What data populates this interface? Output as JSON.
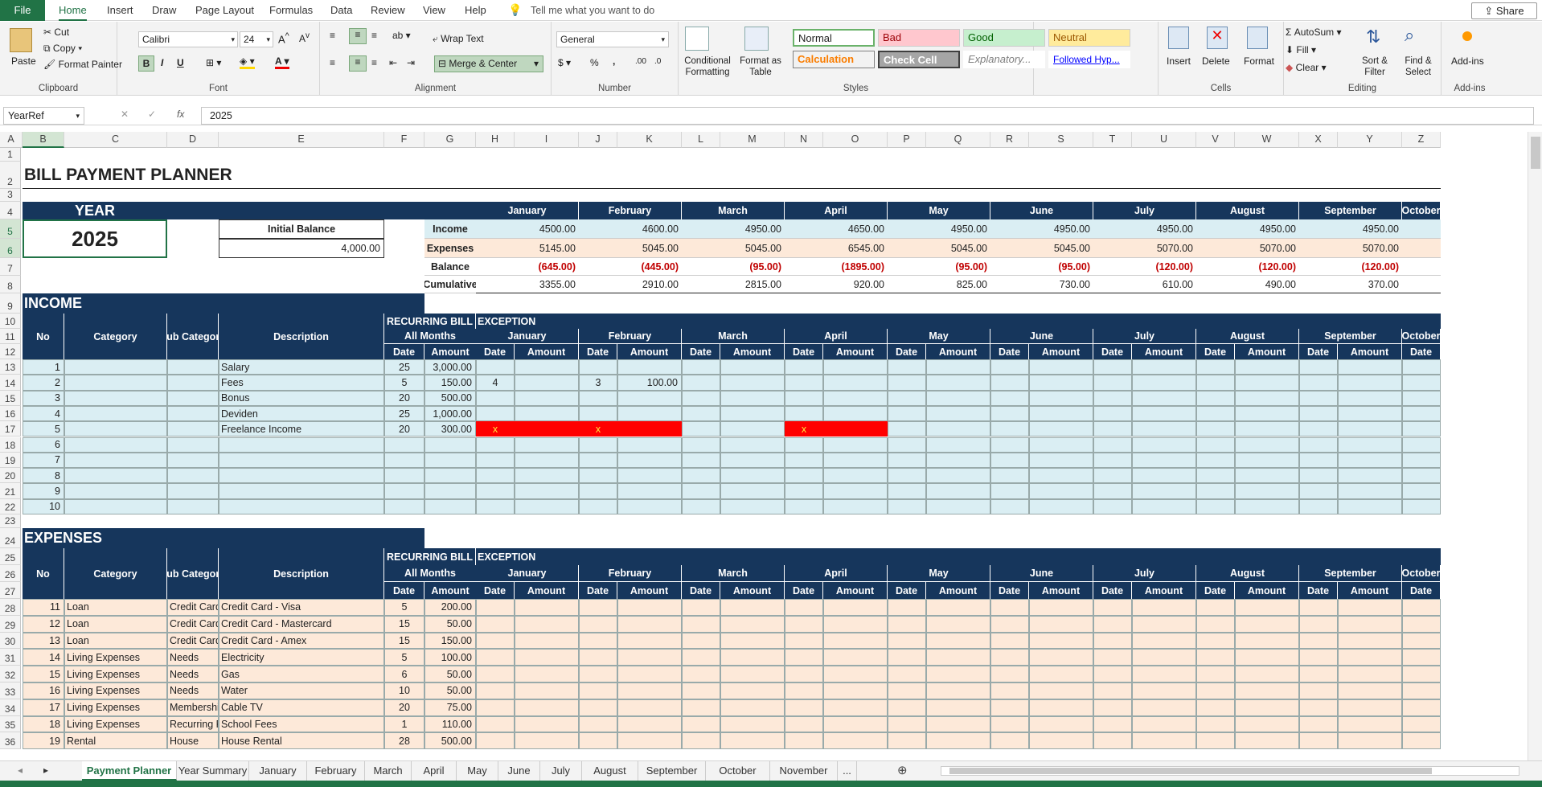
{
  "menu": {
    "file": "File",
    "tabs": [
      "Home",
      "Insert",
      "Draw",
      "Page Layout",
      "Formulas",
      "Data",
      "Review",
      "View",
      "Help"
    ],
    "active_tab": "Home",
    "tell_me": "Tell me what you want to do",
    "share": "Share"
  },
  "ribbon": {
    "clipboard": {
      "paste": "Paste",
      "cut": "Cut",
      "copy": "Copy",
      "format_painter": "Format Painter",
      "label": "Clipboard"
    },
    "font": {
      "name": "Calibri",
      "size": "24",
      "bold": "B",
      "italic": "I",
      "underline": "U",
      "label": "Font"
    },
    "alignment": {
      "wrap": "Wrap Text",
      "merge": "Merge & Center",
      "label": "Alignment"
    },
    "number": {
      "format": "General",
      "label": "Number",
      "percent": "%",
      "comma": ","
    },
    "styles": {
      "conditional": "Conditional Formatting",
      "format_table": "Format as Table",
      "normal": "Normal",
      "bad": "Bad",
      "good": "Good",
      "neutral": "Neutral",
      "calculation": "Calculation",
      "check_cell": "Check Cell",
      "explanatory": "Explanatory...",
      "followed": "Followed Hyp...",
      "label": "Styles"
    },
    "cells": {
      "insert": "Insert",
      "delete": "Delete",
      "format": "Format",
      "label": "Cells"
    },
    "editing": {
      "autosum": "AutoSum",
      "fill": "Fill",
      "clear": "Clear",
      "sort": "Sort & Filter",
      "find": "Find & Select",
      "label": "Editing"
    },
    "addins": {
      "addins": "Add-ins",
      "label": "Add-ins"
    }
  },
  "formula_bar": {
    "name_box": "YearRef",
    "value": "2025",
    "fx": "fx"
  },
  "columns": [
    "A",
    "B",
    "C",
    "D",
    "E",
    "F",
    "G",
    "H",
    "I",
    "J",
    "K",
    "L",
    "M",
    "N",
    "O",
    "P",
    "Q",
    "R",
    "S",
    "T",
    "U",
    "V",
    "W",
    "X",
    "Y",
    "Z"
  ],
  "rows": [
    "1",
    "2",
    "3",
    "4",
    "5",
    "6",
    "7",
    "8",
    "9",
    "10",
    "11",
    "12",
    "13",
    "14",
    "15",
    "16",
    "17",
    "18",
    "19",
    "20",
    "21",
    "22",
    "23",
    "24",
    "25",
    "26",
    "27",
    "28",
    "29",
    "30",
    "31",
    "32",
    "33",
    "34",
    "35",
    "36"
  ],
  "sheet": {
    "title": "BILL PAYMENT PLANNER",
    "year_label": "YEAR",
    "year": "2025",
    "initial_balance_label": "Initial Balance",
    "initial_balance": "4,000.00",
    "months": [
      "January",
      "February",
      "March",
      "April",
      "May",
      "June",
      "July",
      "August",
      "September",
      "October"
    ],
    "summary": {
      "labels": [
        "Income",
        "Expenses",
        "Balance",
        "Cumulative"
      ],
      "income": [
        "4500.00",
        "4600.00",
        "4950.00",
        "4650.00",
        "4950.00",
        "4950.00",
        "4950.00",
        "4950.00",
        "4950.00"
      ],
      "expenses": [
        "5145.00",
        "5045.00",
        "5045.00",
        "6545.00",
        "5045.00",
        "5045.00",
        "5070.00",
        "5070.00",
        "5070.00"
      ],
      "balance": [
        "(645.00)",
        "(445.00)",
        "(95.00)",
        "(1895.00)",
        "(95.00)",
        "(95.00)",
        "(120.00)",
        "(120.00)",
        "(120.00)"
      ],
      "cumulative": [
        "3355.00",
        "2910.00",
        "2815.00",
        "920.00",
        "825.00",
        "730.00",
        "610.00",
        "490.00",
        "370.00"
      ]
    },
    "headers": {
      "no": "No",
      "category": "Category",
      "sub_category": "Sub Category",
      "description": "Description",
      "recurring": "RECURRING BILL",
      "all_months": "All Months",
      "exception": "EXCEPTION",
      "date": "Date",
      "amount": "Amount"
    },
    "income": {
      "title": "INCOME",
      "rows": [
        {
          "no": "1",
          "category": "",
          "sub": "",
          "desc": "Salary",
          "date": "25",
          "amount": "3,000.00"
        },
        {
          "no": "2",
          "category": "",
          "sub": "",
          "desc": "Fees",
          "date": "5",
          "amount": "150.00"
        },
        {
          "no": "3",
          "category": "",
          "sub": "",
          "desc": "Bonus",
          "date": "20",
          "amount": "500.00"
        },
        {
          "no": "4",
          "category": "",
          "sub": "",
          "desc": "Deviden",
          "date": "25",
          "amount": "1,000.00"
        },
        {
          "no": "5",
          "category": "",
          "sub": "",
          "desc": "Freelance Income",
          "date": "20",
          "amount": "300.00"
        },
        {
          "no": "6",
          "category": "",
          "sub": "",
          "desc": "",
          "date": "",
          "amount": ""
        },
        {
          "no": "7",
          "category": "",
          "sub": "",
          "desc": "",
          "date": "",
          "amount": ""
        },
        {
          "no": "8",
          "category": "",
          "sub": "",
          "desc": "",
          "date": "",
          "amount": ""
        },
        {
          "no": "9",
          "category": "",
          "sub": "",
          "desc": "",
          "date": "",
          "amount": ""
        },
        {
          "no": "10",
          "category": "",
          "sub": "",
          "desc": "",
          "date": "",
          "amount": ""
        }
      ],
      "exceptions": {
        "fees_jan_date": "4",
        "fees_feb_date": "3",
        "fees_feb_amount": "100.00",
        "x": "x"
      }
    },
    "expenses": {
      "title": "EXPENSES",
      "rows": [
        {
          "no": "11",
          "category": "Loan",
          "sub": "Credit Card",
          "desc": "Credit Card - Visa",
          "date": "5",
          "amount": "200.00"
        },
        {
          "no": "12",
          "category": "Loan",
          "sub": "Credit Card",
          "desc": "Credit Card - Mastercard",
          "date": "15",
          "amount": "50.00"
        },
        {
          "no": "13",
          "category": "Loan",
          "sub": "Credit Card",
          "desc": "Credit Card - Amex",
          "date": "15",
          "amount": "150.00"
        },
        {
          "no": "14",
          "category": "Living Expenses",
          "sub": "Needs",
          "desc": "Electricity",
          "date": "5",
          "amount": "100.00"
        },
        {
          "no": "15",
          "category": "Living Expenses",
          "sub": "Needs",
          "desc": "Gas",
          "date": "6",
          "amount": "50.00"
        },
        {
          "no": "16",
          "category": "Living Expenses",
          "sub": "Needs",
          "desc": "Water",
          "date": "10",
          "amount": "50.00"
        },
        {
          "no": "17",
          "category": "Living Expenses",
          "sub": "Membership",
          "desc": "Cable TV",
          "date": "20",
          "amount": "75.00"
        },
        {
          "no": "18",
          "category": "Living Expenses",
          "sub": "Recurring Payment",
          "desc": "School Fees",
          "date": "1",
          "amount": "110.00"
        },
        {
          "no": "19",
          "category": "Rental",
          "sub": "House",
          "desc": "House Rental",
          "date": "28",
          "amount": "500.00"
        }
      ]
    }
  },
  "sheet_tabs": [
    "Payment Planner",
    "Year Summary",
    "January",
    "February",
    "March",
    "April",
    "May",
    "June",
    "July",
    "August",
    "September",
    "October",
    "November",
    "..."
  ],
  "active_sheet": "Payment Planner",
  "colors": {
    "accent": "#217346",
    "navy": "#16365c",
    "income_fill": "#daeef3",
    "expense_fill": "#fde9d9",
    "exception_red": "#ff0000",
    "negative": "#c00000"
  }
}
